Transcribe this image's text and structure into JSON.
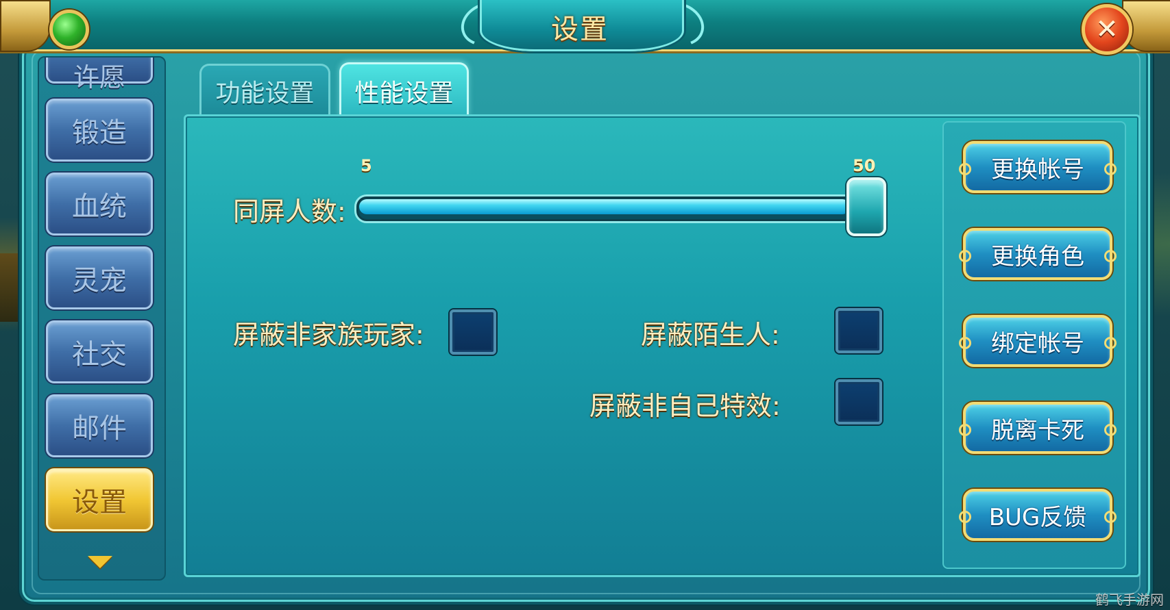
{
  "window": {
    "title": "设置"
  },
  "icons": {
    "gem": "green-gem-icon",
    "close": "close-icon",
    "scroll_down": "chevron-down-icon"
  },
  "sidebar": {
    "items": [
      {
        "label": "许愿"
      },
      {
        "label": "锻造"
      },
      {
        "label": "血统"
      },
      {
        "label": "灵宠"
      },
      {
        "label": "社交"
      },
      {
        "label": "邮件"
      },
      {
        "label": "设置",
        "active": true
      }
    ]
  },
  "tabs": [
    {
      "label": "功能设置",
      "active": false
    },
    {
      "label": "性能设置",
      "active": true
    }
  ],
  "settings": {
    "slider": {
      "label": "同屏人数:",
      "min": "5",
      "max": "50",
      "value": 50
    },
    "checkboxes": [
      {
        "label": "屏蔽非家族玩家:",
        "checked": false
      },
      {
        "label": "屏蔽陌生人:",
        "checked": false
      },
      {
        "label": "屏蔽非自己特效:",
        "checked": false
      }
    ]
  },
  "actions": [
    {
      "label": "更换帐号"
    },
    {
      "label": "更换角色"
    },
    {
      "label": "绑定帐号"
    },
    {
      "label": "脱离卡死"
    },
    {
      "label": "BUG反馈"
    }
  ],
  "watermark": "鹤飞手游网",
  "colors": {
    "accent_gold": "#f1c734",
    "panel_teal": "#1c8796",
    "label_cream": "#ffeec0"
  }
}
